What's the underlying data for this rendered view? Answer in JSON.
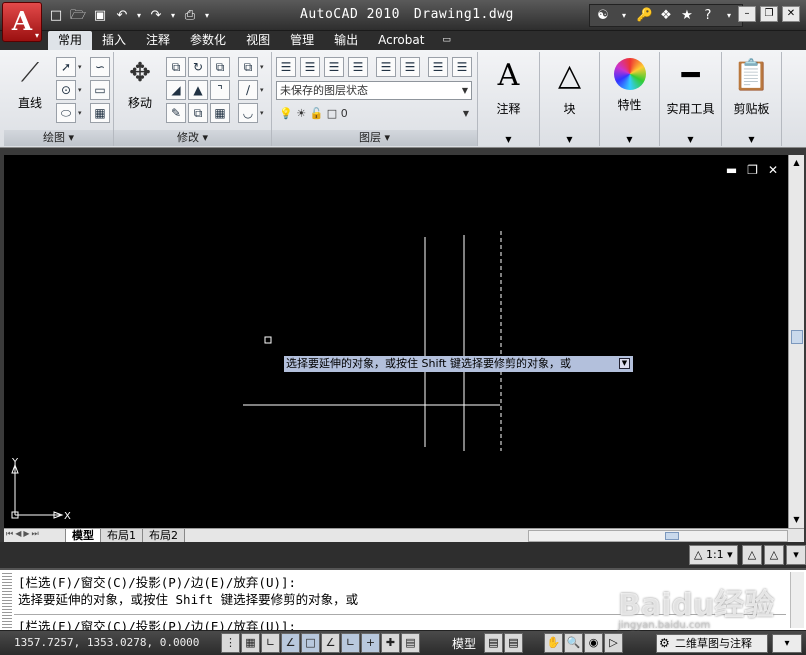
{
  "app": {
    "name": "AutoCAD 2010",
    "file": "Drawing1.dwg",
    "logo_letter": "A"
  },
  "ribbon_tabs": [
    "常用",
    "插入",
    "注释",
    "参数化",
    "视图",
    "管理",
    "输出",
    "Acrobat"
  ],
  "panels": {
    "draw": {
      "title": "绘图",
      "line_label": "直线"
    },
    "modify": {
      "title": "修改",
      "move_label": "移动"
    },
    "layers": {
      "title": "图层",
      "layer_state": "未保存的图层状态",
      "current_layer": "0"
    },
    "annotation": {
      "label": "注释"
    },
    "block": {
      "label": "块"
    },
    "properties": {
      "label": "特性"
    },
    "utilities": {
      "label": "实用工具"
    },
    "clipboard": {
      "label": "剪贴板"
    }
  },
  "viewport": {
    "ucs_x": "X",
    "ucs_y": "Y",
    "tooltip": "选择要延伸的对象，或按住 Shift 键选择要修剪的对象，或",
    "background": "#000000"
  },
  "layout_tabs": [
    "模型",
    "布局1",
    "布局2"
  ],
  "annotation_scale": "1:1",
  "command": {
    "line1": "[栏选(F)/窗交(C)/投影(P)/边(E)/放弃(U)]:",
    "line2": "选择要延伸的对象，或按住 Shift 键选择要修剪的对象，或",
    "line3": "[栏选(F)/窗交(C)/投影(P)/边(E)/放弃(U)]:"
  },
  "status": {
    "coordinates": "1357.7257, 1353.0278, 0.0000",
    "model_label": "模型",
    "workspace": "二维草图与注释"
  },
  "watermark": {
    "text": "Baidu经验",
    "url": "jingyan.baidu.com"
  },
  "colors": {
    "accent": "#c0202a",
    "tooltip_bg": "#b3c0dc",
    "tab_active": "#dfe3e8"
  }
}
